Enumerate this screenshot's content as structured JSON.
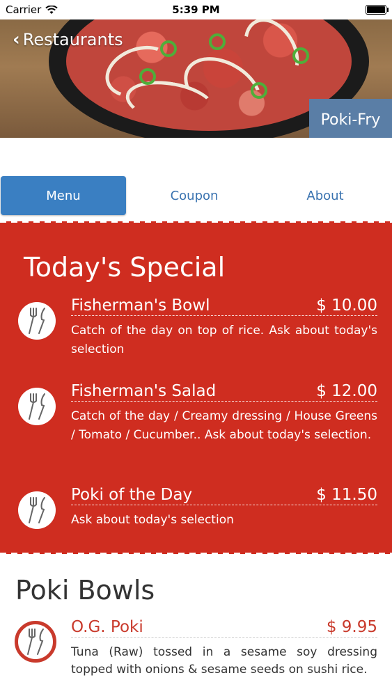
{
  "status_bar": {
    "carrier": "Carrier",
    "time": "5:39 PM"
  },
  "header": {
    "back_label": "Restaurants",
    "restaurant_name": "Poki-Fry"
  },
  "tabs": [
    {
      "label": "Menu",
      "active": true
    },
    {
      "label": "Coupon",
      "active": false
    },
    {
      "label": "About",
      "active": false
    }
  ],
  "special": {
    "title": "Today's Special",
    "items": [
      {
        "name": "Fisherman's Bowl",
        "price": "$ 10.00",
        "description": "Catch of the day on top of rice. Ask about today's selection"
      },
      {
        "name": "Fisherman's Salad",
        "price": "$ 12.00",
        "description": "Catch of the day / Creamy dressing / House Greens / Tomato / Cucumber.. Ask about today's selection."
      },
      {
        "name": "Poki of the Day",
        "price": "$ 11.50",
        "description": "Ask about today's selection"
      }
    ]
  },
  "poki_bowls": {
    "title": "Poki Bowls",
    "items": [
      {
        "name": "O.G. Poki",
        "price": "$ 9.95",
        "description": "Tuna (Raw) tossed in a sesame soy dressing topped with onions & sesame seeds on sushi rice."
      }
    ]
  },
  "colors": {
    "accent_red": "#cf2d20",
    "tab_blue": "#3a7fc2",
    "badge_blue": "#5a7ea6"
  },
  "icons": [
    "wifi-icon",
    "battery-icon",
    "back-chevron-icon",
    "fork-knife-icon"
  ]
}
